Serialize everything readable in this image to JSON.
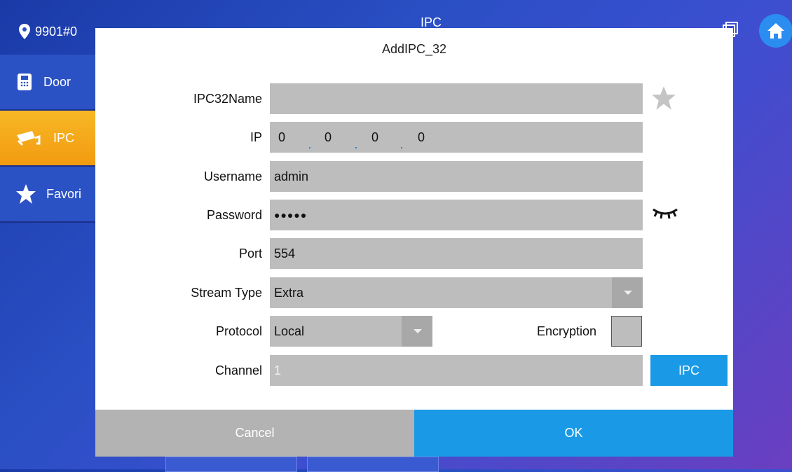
{
  "header": {
    "location": "9901#0",
    "title": "IPC"
  },
  "sidebar": {
    "items": [
      {
        "label": "Door",
        "icon": "door-phone-icon",
        "active": false
      },
      {
        "label": "IPC",
        "icon": "camera-icon",
        "active": true
      },
      {
        "label": "Favori",
        "icon": "star-icon",
        "active": false
      }
    ]
  },
  "dialog": {
    "title": "AddIPC_32",
    "fields": {
      "name": {
        "label": "IPC32Name",
        "value": ""
      },
      "ip": {
        "label": "IP",
        "octets": [
          "0",
          "0",
          "0",
          "0"
        ]
      },
      "username": {
        "label": "Username",
        "value": "admin"
      },
      "password": {
        "label": "Password",
        "value": "●●●●●"
      },
      "port": {
        "label": "Port",
        "value": "554"
      },
      "stream_type": {
        "label": "Stream Type",
        "value": "Extra"
      },
      "protocol": {
        "label": "Protocol",
        "value": "Local"
      },
      "encryption": {
        "label": "Encryption",
        "checked": false
      },
      "channel": {
        "label": "Channel",
        "value": "1"
      }
    },
    "ipc_button": "IPC",
    "cancel": "Cancel",
    "ok": "OK"
  },
  "colors": {
    "accent": "#1a9ae6",
    "active_tab": "#f5a91a",
    "field_bg": "#bdbdbd"
  }
}
